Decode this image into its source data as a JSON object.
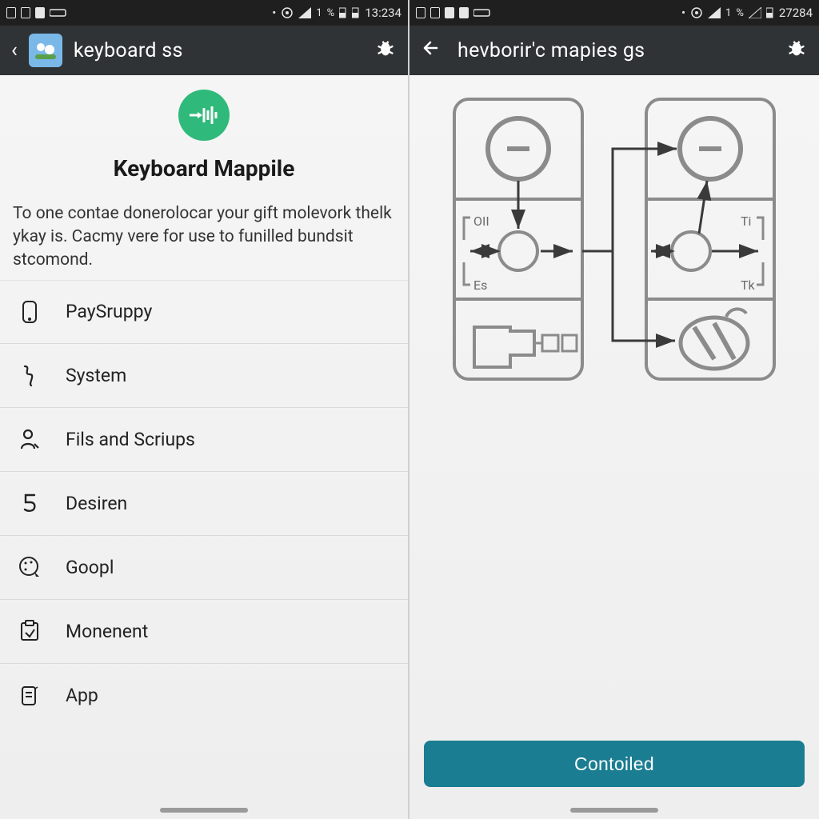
{
  "left": {
    "statusbar": {
      "time": "13:234"
    },
    "appbar": {
      "title": "keyboard ss"
    },
    "hero": {
      "title": "Keyboard Mappile"
    },
    "description": "To one contae donerolocar your gift molevork thelk ykay is. Cacmy vere for use to funilled bundsit stcomond.",
    "items": [
      {
        "label": "PaySruppy"
      },
      {
        "label": "System"
      },
      {
        "label": "Fils and Scriups"
      },
      {
        "label": "Desiren"
      },
      {
        "label": "Goopl"
      },
      {
        "label": "Monenent"
      },
      {
        "label": "App"
      }
    ]
  },
  "right": {
    "statusbar": {
      "time": "27284"
    },
    "appbar": {
      "title": "hevborir'c mapies gs"
    },
    "diagram": {
      "leftCard": {
        "midLeftLabel": "OII",
        "midRightLabel": "Es"
      },
      "rightCard": {
        "midLeftLabel": "Ti",
        "midRightLabel": "Tk"
      }
    },
    "cta": "Contoiled"
  }
}
